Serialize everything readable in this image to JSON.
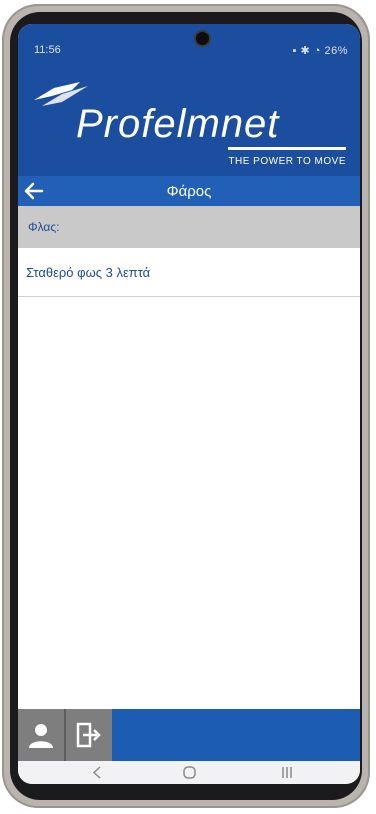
{
  "status_bar": {
    "time": "11:56",
    "right_indicators": "26%"
  },
  "header": {
    "brand_name": "Profelmnet",
    "tagline": "THE POWER TO MOVE"
  },
  "nav": {
    "title": "Φάρος"
  },
  "section": {
    "label": "Φλας:"
  },
  "options": [
    {
      "label": "Σταθερό φως 3 λεπτά"
    }
  ],
  "colors": {
    "primary": "#1c4ea0",
    "nav_bar": "#2260b8",
    "section_bg": "#c9c9c9",
    "text_accent": "#1f4c9a",
    "bottom_bar": "#1c5cb2",
    "button_gray": "#7e7e7e"
  },
  "icons": {
    "back": "back-arrow-icon",
    "profile": "user-icon",
    "logout": "logout-icon",
    "android_back": "chevron-left-icon",
    "android_home": "home-circle-icon",
    "android_recents": "recents-icon"
  }
}
